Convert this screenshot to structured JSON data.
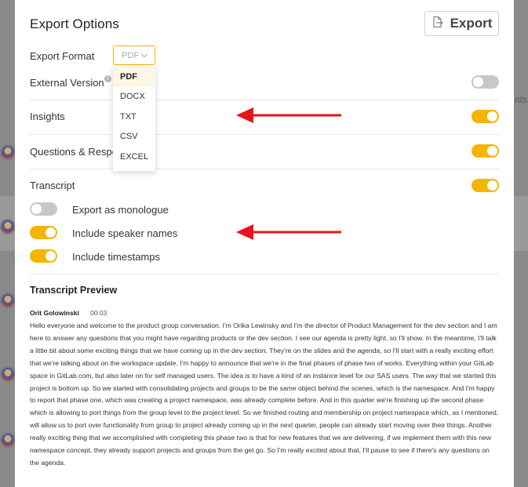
{
  "background": {
    "partial_text": "nts"
  },
  "modal": {
    "title": "Export Options",
    "export_button_label": "Export"
  },
  "export_format": {
    "label": "Export Format",
    "selected_value": "PDF",
    "options": [
      "PDF",
      "DOCX",
      "TXT",
      "CSV",
      "EXCEL"
    ]
  },
  "settings": {
    "external_version": {
      "label": "External Version",
      "enabled": false
    },
    "insights": {
      "label": "Insights",
      "enabled": true
    },
    "questions": {
      "label": "Questions & Respo",
      "enabled": true
    },
    "transcript": {
      "label": "Transcript",
      "enabled": true
    },
    "export_as_monologue": {
      "label": "Export as monologue",
      "enabled": false
    },
    "include_speaker_names": {
      "label": "Include speaker names",
      "enabled": true
    },
    "include_timestamps": {
      "label": "Include timestamps",
      "enabled": true
    }
  },
  "preview": {
    "title": "Transcript Preview",
    "speaker": "Orit Golowinski",
    "timestamp": "00:03",
    "text": "Hello everyone and welcome to the product group conversation. I'm Orika Lewinsky and I'm the director of Product Management for the dev section and I am here to answer any questions that you might have regarding products or the dev section. I see our agenda is pretty light, so I'll show. In the meantime, I'll talk a little bit about some exciting things that we have coming up in the dev section. They're on the slides and the agenda, so I'll start with a really exciting effort that we're talking about on the workspace update. I'm happy to announce that we're in the final phases of phase two of works. Everything within your GitLab space in GitLab.com, but also later on for self managed users. The idea is to have a kind of an instance level for our SAS users. The way that we started this project is bottom up. So we started with consolidating projects and groups to be the same object behind the scenes, which is the namespace. And I'm happy to report that phase one, which was creating a project namespace, was already complete before. And in this quarter we're finishing up the second phase which is allowing to port things from the group level to the project level. So we finished routing and membership on project namespace which, as I mentioned, will allow us to port over functionality from group to project already coming up in the next quarter, people can already start moving over their things. Another really exciting thing that we accomplished with completing this phase two is that for new features that we are delivering, if we implement them with this new namespace concept, they already support projects and groups from the get go. So I'm really excited about that. I'll pause to see if there's any questions on the agenda."
  },
  "colors": {
    "accent": "#f5b400",
    "toggle_off": "#c7c7c7",
    "arrow": "#e8141b"
  },
  "icons": {
    "export": "export-icon",
    "info": "info-icon",
    "chevron": "chevron-down-icon"
  }
}
